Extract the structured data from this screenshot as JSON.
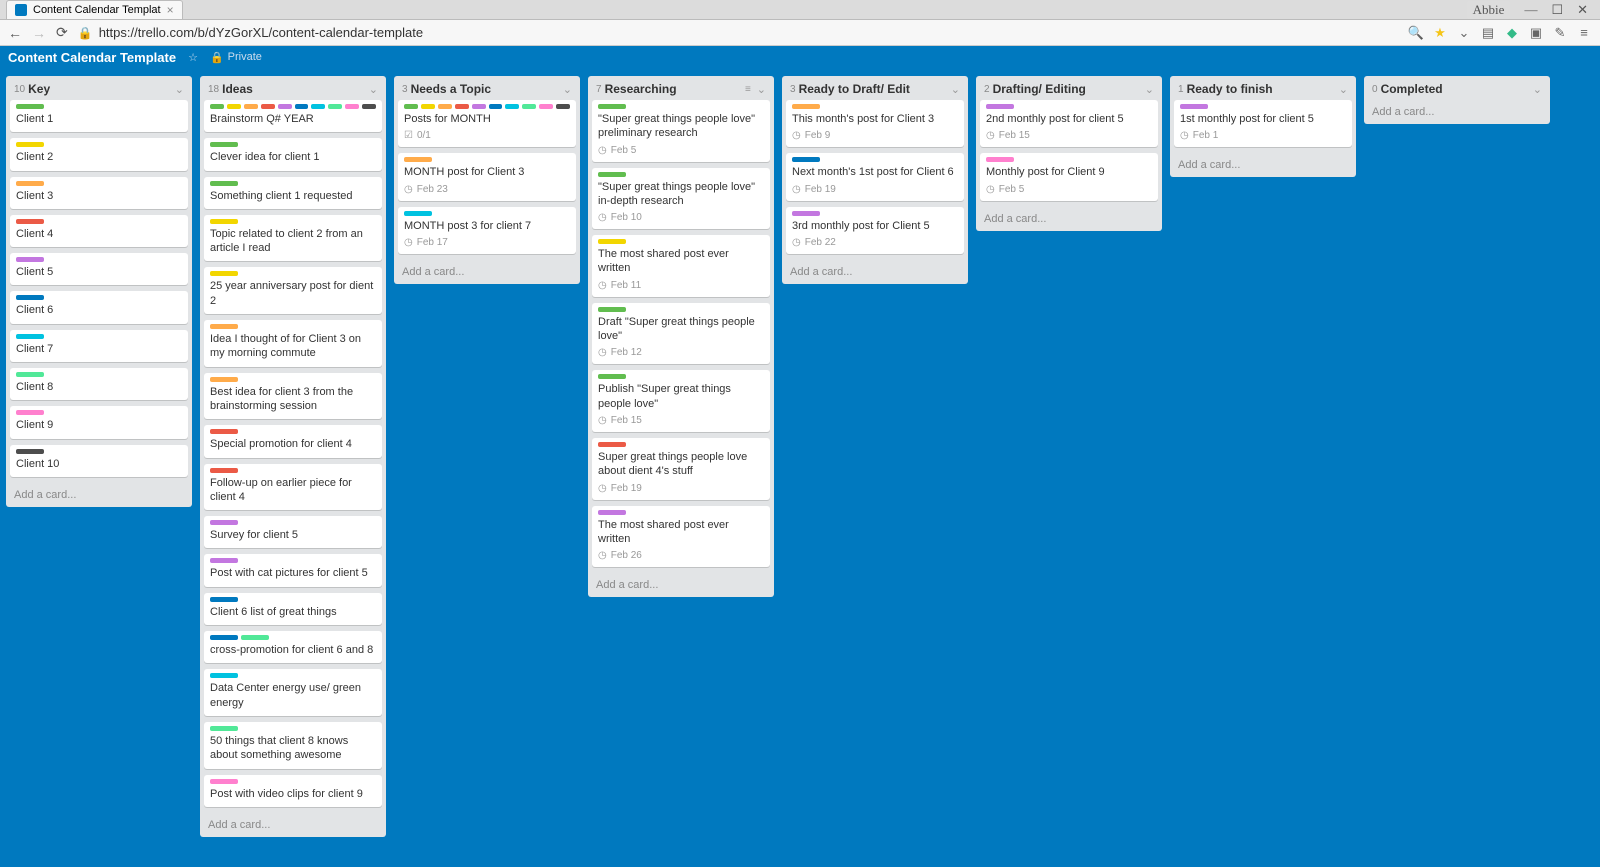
{
  "browser": {
    "tab_title": "Content Calendar Templat",
    "url": "https://trello.com/b/dYzGorXL/content-calendar-template",
    "user_badge": "Abbie"
  },
  "header": {
    "board_title": "Content Calendar Template",
    "privacy": "Private"
  },
  "add_card_label": "Add a card...",
  "lists": [
    {
      "count": "10",
      "title": "Key",
      "cards": [
        {
          "labels": [
            "green"
          ],
          "title": "Client 1"
        },
        {
          "labels": [
            "yellow"
          ],
          "title": "Client 2"
        },
        {
          "labels": [
            "orange"
          ],
          "title": "Client 3"
        },
        {
          "labels": [
            "red"
          ],
          "title": "Client 4"
        },
        {
          "labels": [
            "purple"
          ],
          "title": "Client 5"
        },
        {
          "labels": [
            "blue"
          ],
          "title": "Client 6"
        },
        {
          "labels": [
            "sky"
          ],
          "title": "Client 7"
        },
        {
          "labels": [
            "lime"
          ],
          "title": "Client 8"
        },
        {
          "labels": [
            "pink"
          ],
          "title": "Client 9"
        },
        {
          "labels": [
            "black"
          ],
          "title": "Client 10"
        }
      ]
    },
    {
      "count": "18",
      "title": "Ideas",
      "cards": [
        {
          "labels": [
            "green",
            "yellow",
            "orange",
            "red",
            "purple",
            "blue",
            "sky",
            "lime",
            "pink",
            "black"
          ],
          "small": true,
          "title": "Brainstorm Q# YEAR"
        },
        {
          "labels": [
            "green"
          ],
          "title": "Clever idea for client 1"
        },
        {
          "labels": [
            "green"
          ],
          "title": "Something client 1 requested"
        },
        {
          "labels": [
            "yellow"
          ],
          "title": "Topic related to client 2 from an article I read"
        },
        {
          "labels": [
            "yellow"
          ],
          "title": "25 year anniversary post for dient 2"
        },
        {
          "labels": [
            "orange"
          ],
          "title": "Idea I thought of for Client 3 on my morning commute"
        },
        {
          "labels": [
            "orange"
          ],
          "title": "Best idea for client 3 from the brainstorming session"
        },
        {
          "labels": [
            "red"
          ],
          "title": "Special promotion for client 4"
        },
        {
          "labels": [
            "red"
          ],
          "title": "Follow-up on earlier piece for client 4"
        },
        {
          "labels": [
            "purple"
          ],
          "title": "Survey for client 5"
        },
        {
          "labels": [
            "purple"
          ],
          "title": "Post with cat pictures for client 5"
        },
        {
          "labels": [
            "blue"
          ],
          "title": "Client 6 list of great things"
        },
        {
          "labels": [
            "blue",
            "lime"
          ],
          "title": "cross-promotion for client 6 and 8"
        },
        {
          "labels": [
            "sky"
          ],
          "title": "Data Center energy use/ green energy"
        },
        {
          "labels": [
            "lime"
          ],
          "title": "50 things that client 8 knows about something awesome"
        },
        {
          "labels": [
            "pink"
          ],
          "title": "Post with video clips for client 9"
        }
      ]
    },
    {
      "count": "3",
      "title": "Needs a Topic",
      "cards": [
        {
          "labels": [
            "green",
            "yellow",
            "orange",
            "red",
            "purple",
            "blue",
            "sky",
            "lime",
            "pink",
            "black"
          ],
          "small": true,
          "title": "Posts for MONTH",
          "badge_check": "0/1"
        },
        {
          "labels": [
            "orange"
          ],
          "title": "MONTH post for Client 3",
          "badge_date": "Feb 23"
        },
        {
          "labels": [
            "sky"
          ],
          "title": "MONTH post 3 for client 7",
          "badge_date": "Feb 17"
        }
      ]
    },
    {
      "count": "7",
      "title": "Researching",
      "extra": "≡",
      "cards": [
        {
          "labels": [
            "green"
          ],
          "title": "\"Super great things people love\" preliminary research",
          "badge_date": "Feb 5"
        },
        {
          "labels": [
            "green"
          ],
          "title": "\"Super great things people love\" in-depth research",
          "badge_date": "Feb 10"
        },
        {
          "labels": [
            "yellow"
          ],
          "title": "The most shared post ever written",
          "badge_date": "Feb 11"
        },
        {
          "labels": [
            "green"
          ],
          "title": "Draft \"Super great things people love\"",
          "badge_date": "Feb 12"
        },
        {
          "labels": [
            "green"
          ],
          "title": "Publish \"Super great things people love\"",
          "badge_date": "Feb 15"
        },
        {
          "labels": [
            "red"
          ],
          "title": "Super great things people love about dient 4's stuff",
          "badge_date": "Feb 19"
        },
        {
          "labels": [
            "purple"
          ],
          "title": "The most shared post ever written",
          "badge_date": "Feb 26"
        }
      ]
    },
    {
      "count": "3",
      "title": "Ready to Draft/ Edit",
      "cards": [
        {
          "labels": [
            "orange"
          ],
          "title": "This month's post for Client 3",
          "badge_date": "Feb 9"
        },
        {
          "labels": [
            "blue"
          ],
          "title": "Next month's 1st post for Client 6",
          "badge_date": "Feb 19"
        },
        {
          "labels": [
            "purple"
          ],
          "title": "3rd monthly post for Client 5",
          "badge_date": "Feb 22"
        }
      ]
    },
    {
      "count": "2",
      "title": "Drafting/ Editing",
      "cards": [
        {
          "labels": [
            "purple"
          ],
          "title": "2nd monthly post for client 5",
          "badge_date": "Feb 15"
        },
        {
          "labels": [
            "pink"
          ],
          "title": "Monthly post for Client 9",
          "badge_date": "Feb 5"
        }
      ]
    },
    {
      "count": "1",
      "title": "Ready to finish",
      "cards": [
        {
          "labels": [
            "purple"
          ],
          "title": "1st monthly post for client 5",
          "badge_date": "Feb 1"
        }
      ]
    },
    {
      "count": "0",
      "title": "Completed",
      "cards": []
    }
  ]
}
